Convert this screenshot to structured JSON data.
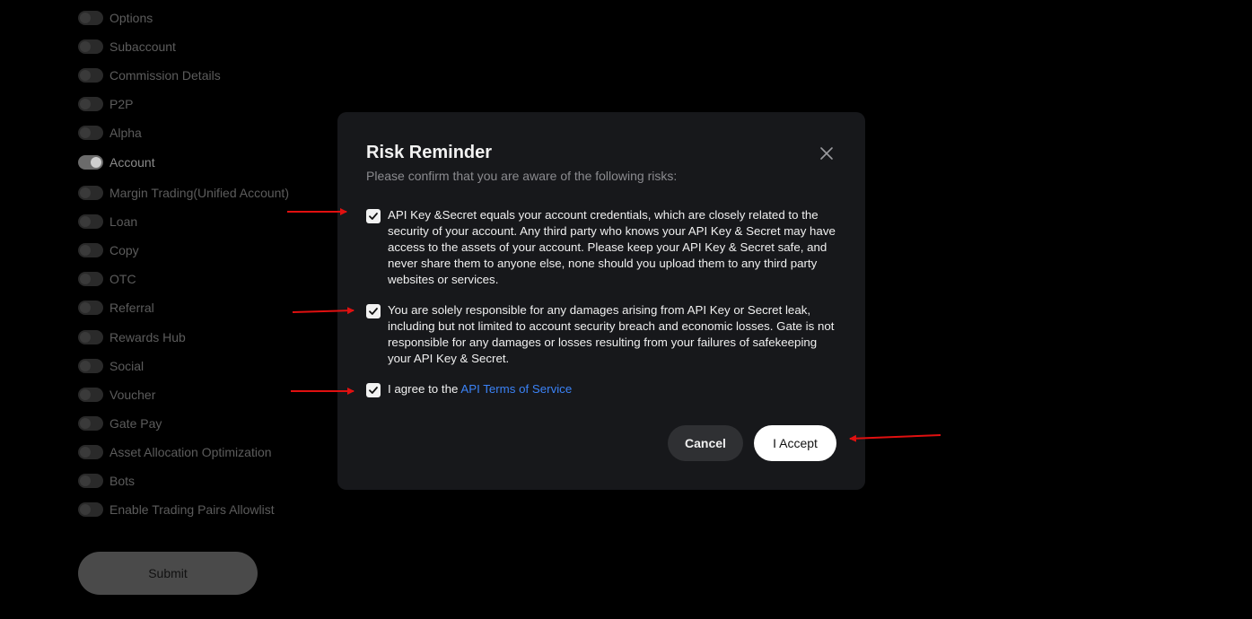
{
  "permissions": [
    {
      "label": "Options",
      "on": false
    },
    {
      "label": "Subaccount",
      "on": false
    },
    {
      "label": "Commission Details",
      "on": false
    },
    {
      "label": "P2P",
      "on": false
    },
    {
      "label": "Alpha",
      "on": false
    },
    {
      "label": "Account",
      "on": true
    },
    {
      "label": "Margin Trading(Unified Account)",
      "on": false
    },
    {
      "label": "Loan",
      "on": false
    },
    {
      "label": "Copy",
      "on": false
    },
    {
      "label": "OTC",
      "on": false
    },
    {
      "label": "Referral",
      "on": false
    },
    {
      "label": "Rewards Hub",
      "on": false
    },
    {
      "label": "Social",
      "on": false
    },
    {
      "label": "Voucher",
      "on": false
    },
    {
      "label": "Gate Pay",
      "on": false
    },
    {
      "label": "Asset Allocation Optimization",
      "on": false
    },
    {
      "label": "Bots",
      "on": false
    },
    {
      "label": "Enable Trading Pairs Allowlist",
      "on": false
    }
  ],
  "submit_label": "Submit",
  "modal": {
    "title": "Risk Reminder",
    "subtitle": "Please confirm that you are aware of the following risks:",
    "close_icon": "close-icon",
    "risks": [
      {
        "text": "API Key &Secret equals your account credentials, which are closely related to the security of your account. Any third party who knows your API Key & Secret may have access to the assets of your account. Please keep your API Key & Secret safe, and never share them to anyone else, none should you upload them to any third party websites or services.",
        "checked": true
      },
      {
        "text": "You are solely responsible for any damages arising from API Key or Secret leak, including but not limited to account security breach and economic losses. Gate is not responsible for any damages or losses resulting from your failures of safekeeping your API Key & Secret.",
        "checked": true
      }
    ],
    "agree_prefix": "I agree to the ",
    "agree_link": "API Terms of Service",
    "agree_checked": true,
    "cancel_label": "Cancel",
    "accept_label": "I Accept"
  },
  "colors": {
    "background": "#000000",
    "modal_bg": "#17181b",
    "link": "#3b82f6",
    "annotation_arrow": "#e01010"
  }
}
